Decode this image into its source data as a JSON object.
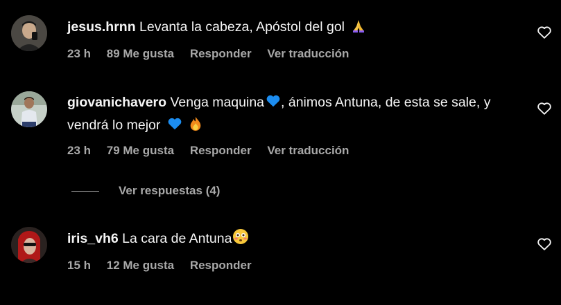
{
  "comments": [
    {
      "username": "jesus.hrnn",
      "text": "Levanta la cabeza, Apóstol del gol",
      "emoji": "praying-hands",
      "time": "23 h",
      "likes": "89 Me gusta",
      "reply_label": "Responder",
      "translate_label": "Ver traducción"
    },
    {
      "username": "giovanichavero",
      "text_part1": "Venga maquina",
      "text_part2": ", ánimos Antuna, de esta se sale, y vendrá lo mejor",
      "emojis": [
        "blue-heart",
        "blue-heart",
        "fire"
      ],
      "time": "23 h",
      "likes": "79 Me gusta",
      "reply_label": "Responder",
      "translate_label": "Ver traducción",
      "view_replies": "Ver respuestas (4)"
    },
    {
      "username": "iris_vh6",
      "text": "La cara de Antuna",
      "emoji": "flushed-face",
      "time": "15 h",
      "likes": "12 Me gusta",
      "reply_label": "Responder"
    }
  ],
  "colors": {
    "background": "#000000",
    "primary_text": "#f5f5f5",
    "secondary_text": "#a8a8a8",
    "blue_heart": "#1c8df0",
    "fire": "#f08a1c"
  }
}
